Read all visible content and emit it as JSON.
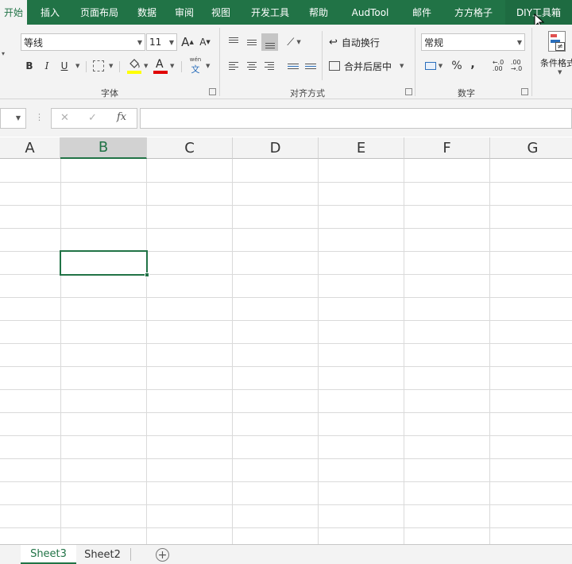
{
  "tabs": [
    "开始",
    "插入",
    "页面布局",
    "数据",
    "审阅",
    "视图",
    "开发工具",
    "帮助",
    "AudTool",
    "邮件",
    "方方格子",
    "DIY工具箱"
  ],
  "ribbon": {
    "font_name": "等线",
    "font_size": "11",
    "grow_font": "A",
    "shrink_font": "A",
    "bold": "B",
    "italic": "I",
    "underline": "U",
    "font_color_letter": "A",
    "phonetic_top": "wén",
    "phonetic_bottom": "文",
    "font_group_label": "字体",
    "wrap_text_label": "自动换行",
    "merge_center_label": "合并后居中",
    "alignment_group_label": "对齐方式",
    "number_format": "常规",
    "percent": "%",
    "comma": ",",
    "number_group_label": "数字",
    "conditional_format_label": "条件格式",
    "conditional_format_icon_text": "≠"
  },
  "formula_bar": {
    "cancel": "✕",
    "enter": "✓",
    "fx": "fx",
    "value": ""
  },
  "columns": [
    "A",
    "B",
    "C",
    "D",
    "E",
    "F",
    "G"
  ],
  "selected_column": "B",
  "active_cell": "B5",
  "sheets": [
    "Sheet3",
    "Sheet2"
  ],
  "active_sheet": "Sheet3",
  "colors": {
    "accent": "#217346",
    "tab_text": "#ffffff",
    "ribbon_bg": "#f3f3f3",
    "gridline": "#dadada",
    "font_color_bar": "#e00000",
    "fill_color_bar": "#ffff00"
  }
}
